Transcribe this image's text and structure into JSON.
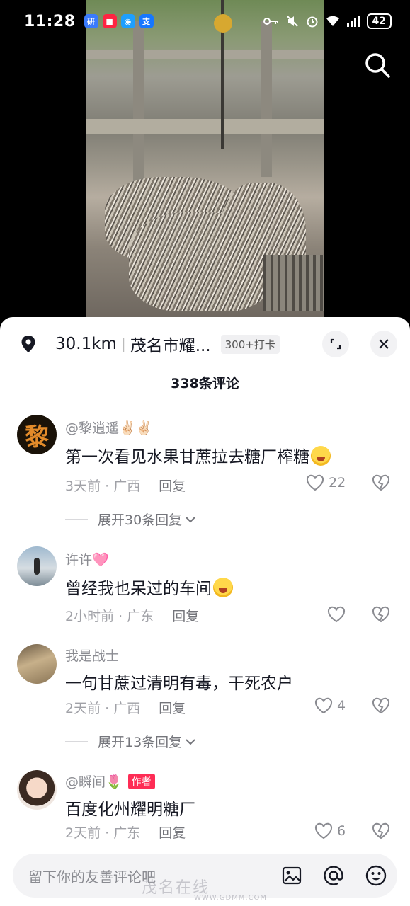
{
  "status_bar": {
    "time": "11:28",
    "apps": [
      {
        "icon": "translate-app-icon",
        "glyph": "研",
        "color": "#3a7bfd"
      },
      {
        "icon": "red-book-app-icon",
        "glyph": "■",
        "color": "#ff2442"
      },
      {
        "icon": "camera-app-icon",
        "glyph": "◉",
        "color": "#1e9fff"
      },
      {
        "icon": "alipay-app-icon",
        "glyph": "支",
        "color": "#1677ff"
      }
    ],
    "battery": "42"
  },
  "location": {
    "distance": "30.1km",
    "name": "茂名市耀...",
    "badge": "300+打卡"
  },
  "comments_title": "338条评论",
  "comments": [
    {
      "user": "@黎逍遥✌🏻✌🏻",
      "text": "第一次看见水果甘蔗拉去糖厂榨糖",
      "time": "3天前",
      "region": "广西",
      "reply": "回复",
      "likes": "22",
      "expand": "展开30条回复"
    },
    {
      "user": "许许🩷",
      "text": "曾经我也呆过的车间",
      "time": "2小时前",
      "region": "广东",
      "reply": "回复",
      "likes": ""
    },
    {
      "user": "我是战士",
      "text": "一句甘蔗过清明有毒，干死农户",
      "time": "2天前",
      "region": "广西",
      "reply": "回复",
      "likes": "4",
      "expand": "展开13条回复"
    },
    {
      "user": "@瞬间🌷",
      "author_badge": "作者",
      "text": "百度化州耀明糖厂",
      "time": "2天前",
      "region": "广东",
      "reply": "回复",
      "likes": "6"
    }
  ],
  "input": {
    "placeholder": "留下你的友善评论吧"
  },
  "watermark": {
    "text": "茂名在线",
    "url": "WWW.GDMM.COM"
  },
  "colors": {
    "accent": "#fe2c55",
    "text": "#161823",
    "muted": "#8a8b91"
  }
}
